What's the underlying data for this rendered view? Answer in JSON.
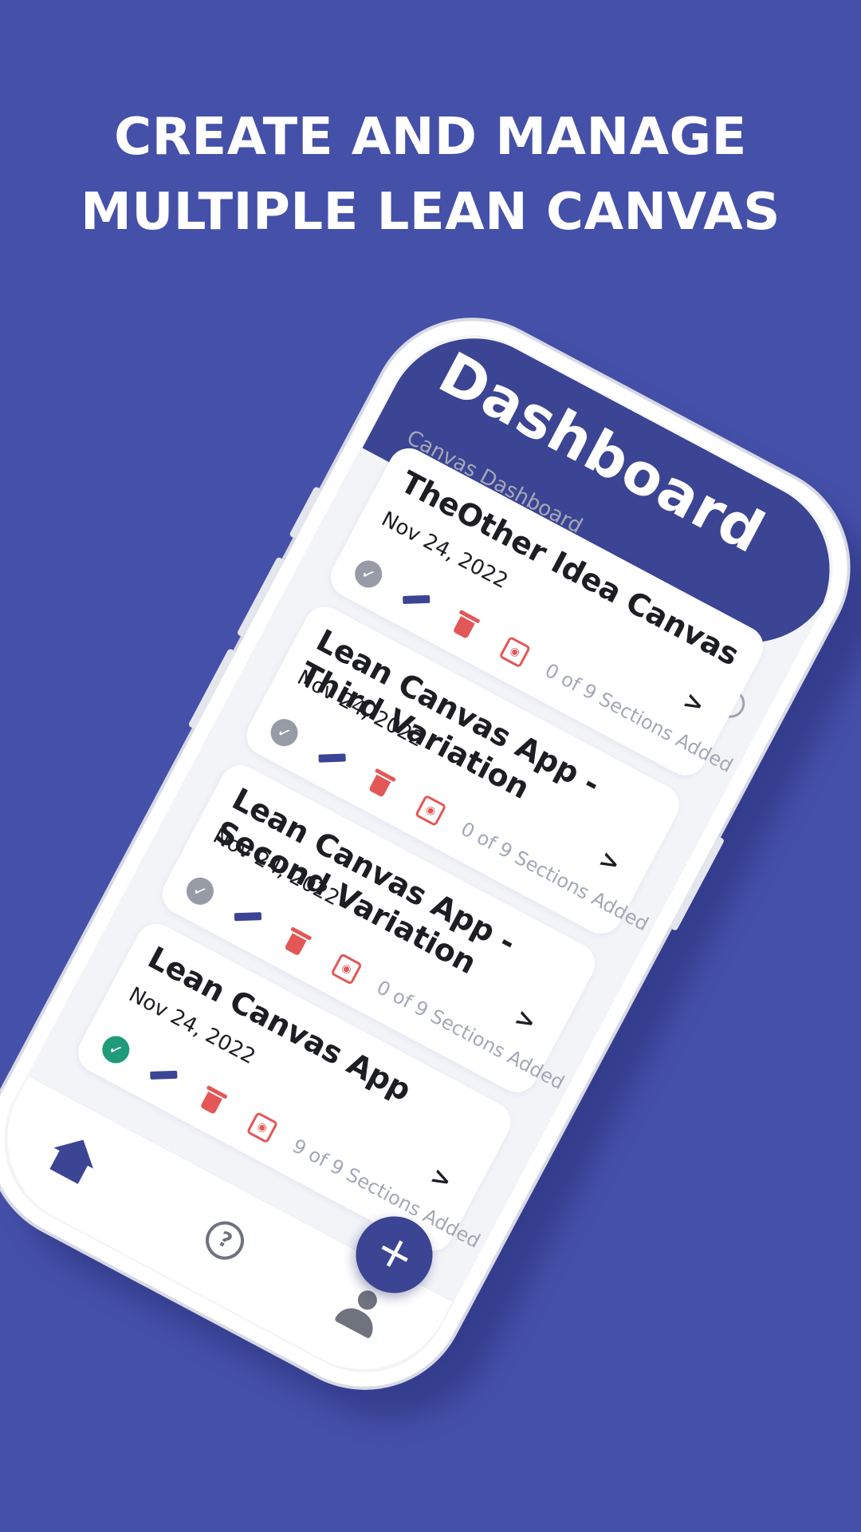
{
  "headline": {
    "line1": "CREATE AND MANAGE",
    "line2": "MULTIPLE LEAN CANVAS"
  },
  "app": {
    "header_title": "Dashboard",
    "subtitle": "Canvas Dashboard",
    "help_glyph": "?",
    "fab_glyph": "+",
    "chevron_glyph": ">",
    "check_glyph": "✓",
    "view_glyph": "◉"
  },
  "canvases": [
    {
      "title": "TheOther Idea Canvas",
      "date": "Nov 24, 2022",
      "sections": "0 of 9 Sections Added",
      "status": "incomplete"
    },
    {
      "title": "Lean Canvas App - Third Variation",
      "date": "Nov 24, 2022",
      "sections": "0 of 9 Sections Added",
      "status": "incomplete"
    },
    {
      "title": "Lean Canvas App - Second Variation",
      "date": "Nov 24, 2022",
      "sections": "0 of 9 Sections Added",
      "status": "incomplete"
    },
    {
      "title": "Lean Canvas App",
      "date": "Nov 24, 2022",
      "sections": "9 of 9 Sections Added",
      "status": "complete"
    }
  ],
  "icons": {
    "status": "check-circle-icon",
    "edit": "pencil-icon",
    "delete": "trash-icon",
    "view": "eye-icon",
    "open": "chevron-right-icon",
    "nav_home": "home-icon",
    "nav_help": "help-icon",
    "nav_profile": "user-icon",
    "fab": "plus-icon"
  },
  "colors": {
    "background": "#4550a9",
    "primary": "#3c4494",
    "danger": "#e45757",
    "complete": "#1f9b7a",
    "incomplete": "#969ba6"
  }
}
